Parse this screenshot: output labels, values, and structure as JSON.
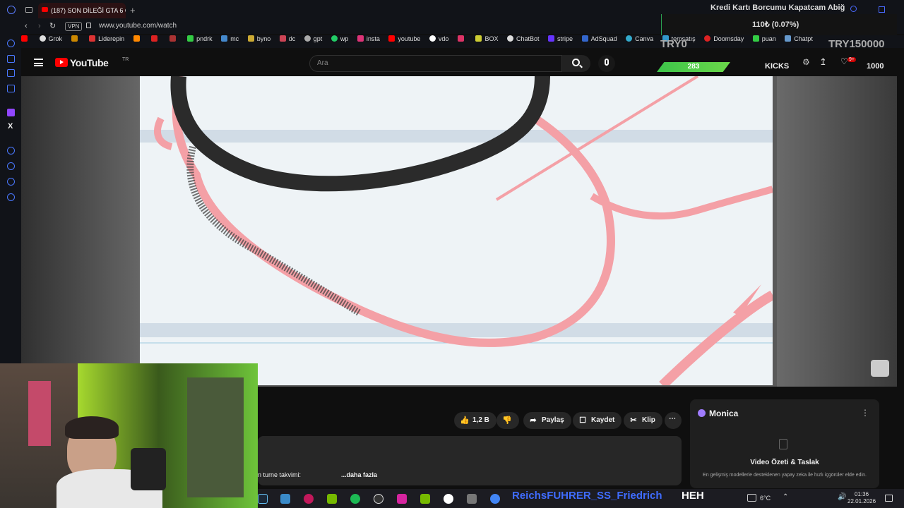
{
  "browser": {
    "tab_title": "(187) SON DİLEĞİ GTA 6 O",
    "new_tab": "+",
    "vpn": "VPN",
    "url": "www.youtube.com/watch"
  },
  "bookmarks": [
    "",
    "Grok",
    "",
    "Liderepin",
    "",
    "",
    "",
    "pndrk",
    "mc",
    "byno",
    "dc",
    "gpt",
    "wp",
    "insta",
    "youtube",
    "vdo",
    "",
    "BOX",
    "ChatBot",
    "stripe",
    "AdSquad",
    "Canva",
    "temsatış",
    "Doomsday",
    "puan",
    "Chatpt"
  ],
  "youtube": {
    "logo_text": "YouTube",
    "region": "TR",
    "search_placeholder": "Ara"
  },
  "stream_overlay": {
    "title": "Kredi Kartı Borcumu Kapatcam Abiğ",
    "value": "110₺ (0.07%)",
    "try_current": "TRY0",
    "try_goal": "TRY150000",
    "green_count": "283",
    "kicks": "KICKS",
    "kicks_count": "1000",
    "notif_badge": "9+"
  },
  "actions": {
    "like": "1,2 B",
    "share": "Paylaş",
    "save": "Kaydet",
    "clip": "Klip",
    "more": "⋯"
  },
  "description": {
    "text": "n turne takvimi:",
    "more": "...daha fazla"
  },
  "monica": {
    "name": "Monica",
    "title": "Video Özeti & Taslak",
    "subtitle": "En gelişmiş modellerle desteklenen yapay zeka ile hızlı içgörüler elde edin."
  },
  "taskbar": {
    "marquee": "ReichsFUHRER_SS_Friedrich",
    "heh": "HEH",
    "temp": "6°C",
    "time": "01:36",
    "date": "22.01.2026"
  },
  "colors": {
    "youtube_red": "#ff0000",
    "overlay_green": "#3cc44a",
    "marquee_blue": "#3f6cff",
    "drawing_pink": "#f4a0a6",
    "drawing_black": "#2b2b2b"
  }
}
